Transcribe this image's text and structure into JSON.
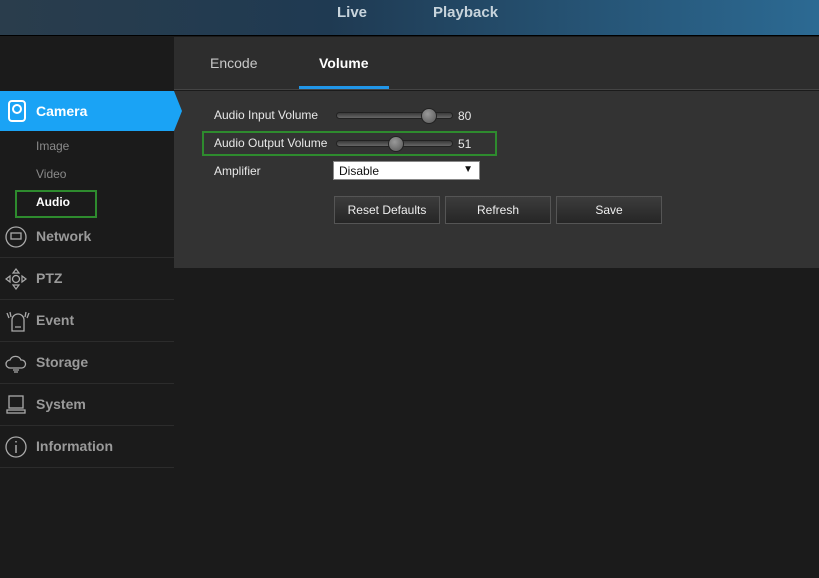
{
  "top_nav": [
    "Live",
    "Playback"
  ],
  "tabs": [
    "Encode",
    "Volume"
  ],
  "sidebar": {
    "camera": "Camera",
    "sub": [
      "Image",
      "Video",
      "Audio"
    ],
    "items": [
      "Network",
      "PTZ",
      "Event",
      "Storage",
      "System",
      "Information"
    ]
  },
  "form": {
    "input_label": "Audio Input Volume",
    "input_value": "80",
    "input_level": 80,
    "output_label": "Audio Output Volume",
    "output_value": "51",
    "output_level": 51,
    "amp_label": "Amplifier",
    "amp_value": "Disable"
  },
  "buttons": {
    "reset": "Reset Defaults",
    "refresh": "Refresh",
    "save": "Save"
  },
  "colors": {
    "accent": "#1aa3f5",
    "highlight": "#2e8b2e"
  }
}
